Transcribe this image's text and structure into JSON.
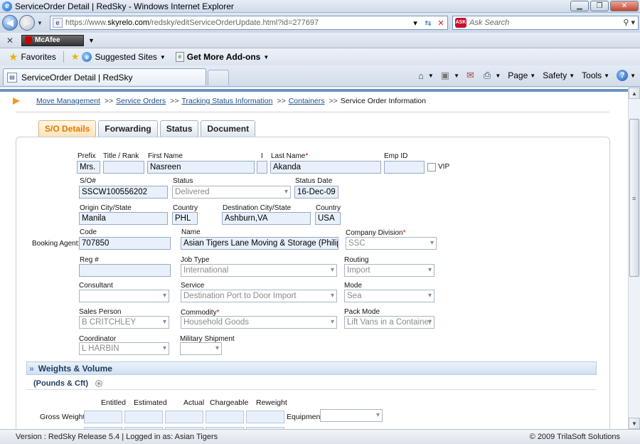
{
  "window": {
    "title": "ServiceOrder Detail | RedSky - Windows Internet Explorer",
    "buttons": {
      "minimize": "▁",
      "restore": "❐",
      "close": "✕"
    }
  },
  "address": {
    "url_prefix": "https://www.",
    "url_domain": "skyrelo.com",
    "url_rest": "/redsky/editServiceOrderUpdate.html?id=277697",
    "search_placeholder": "Ask Search"
  },
  "toolbar": {
    "mcafee_label": "McAfee"
  },
  "favorites": {
    "favorites_label": "Favorites",
    "suggested_sites": "Suggested Sites",
    "addons": "Get More Add-ons"
  },
  "tab": {
    "title": "ServiceOrder Detail | RedSky"
  },
  "commands": {
    "page": "Page",
    "safety": "Safety",
    "tools": "Tools"
  },
  "breadcrumb": {
    "items": [
      "Move Management",
      "Service Orders",
      "Tracking Status Information",
      "Containers"
    ],
    "separator": ">>",
    "current": "Service Order Information"
  },
  "form_tabs": [
    "S/O Details",
    "Forwarding",
    "Status",
    "Document"
  ],
  "form": {
    "prefix": {
      "label": "Prefix",
      "value": "Mrs."
    },
    "title_rank": {
      "label": "Title / Rank",
      "value": ""
    },
    "first_name": {
      "label": "First Name",
      "value": "Nasreen"
    },
    "initial": {
      "label": "I",
      "value": ""
    },
    "last_name": {
      "label": "Last Name",
      "value": "Akanda",
      "required": "*"
    },
    "emp_id": {
      "label": "Emp ID",
      "value": ""
    },
    "vip": {
      "label": "VIP"
    },
    "so_number": {
      "label": "S/O#",
      "value": "SSCW100556202"
    },
    "status": {
      "label": "Status",
      "value": "Delivered"
    },
    "status_date": {
      "label": "Status Date",
      "value": "16-Dec-09"
    },
    "origin_city": {
      "label": "Origin  City/State",
      "value": "Manila"
    },
    "origin_country": {
      "label": "Country",
      "value": "PHL"
    },
    "dest_city": {
      "label": "Destination City/State",
      "value": "Ashburn,VA"
    },
    "dest_country": {
      "label": "Country",
      "value": "USA"
    },
    "booking_agent": {
      "label": "Booking Agent:"
    },
    "code": {
      "label": "Code",
      "value": "707850"
    },
    "name": {
      "label": "Name",
      "value": "Asian Tigers Lane Moving & Storage (Philippines)"
    },
    "company_division": {
      "label": "Company Division",
      "value": "SSC",
      "required": "*"
    },
    "reg": {
      "label": "Reg #",
      "value": ""
    },
    "job_type": {
      "label": "Job Type",
      "value": "International"
    },
    "routing": {
      "label": "Routing",
      "value": "Import"
    },
    "consultant": {
      "label": "Consultant",
      "value": ""
    },
    "service": {
      "label": "Service",
      "value": "Destination Port to Door Import"
    },
    "mode": {
      "label": "Mode",
      "value": "Sea"
    },
    "sales_person": {
      "label": "Sales Person",
      "value": "B CRITCHLEY"
    },
    "commodity": {
      "label": "Commodity",
      "value": "Household Goods",
      "required": "*"
    },
    "pack_mode": {
      "label": "Pack Mode",
      "value": "Lift Vans in a Container"
    },
    "coordinator": {
      "label": "Coordinator",
      "value": "L HARBIN"
    },
    "military_shipment": {
      "label": "Military Shipment",
      "value": ""
    }
  },
  "weights": {
    "section_title": "Weights & Volume",
    "units": "(Pounds & Cft)",
    "columns": [
      "Entitled",
      "Estimated",
      "Actual",
      "Chargeable",
      "Reweight"
    ],
    "row_label": "Gross Weight",
    "equipment_label": "Equipment"
  },
  "statusbar": {
    "left": "Version : RedSky Release 5.4 | Logged in as: Asian Tigers",
    "right": "© 2009 TrilaSoft Solutions"
  },
  "colors": {
    "active_tab": "#e07a00",
    "link": "#1b4f8a",
    "input_bg": "#e8f1fb",
    "required": "#dd0000"
  }
}
